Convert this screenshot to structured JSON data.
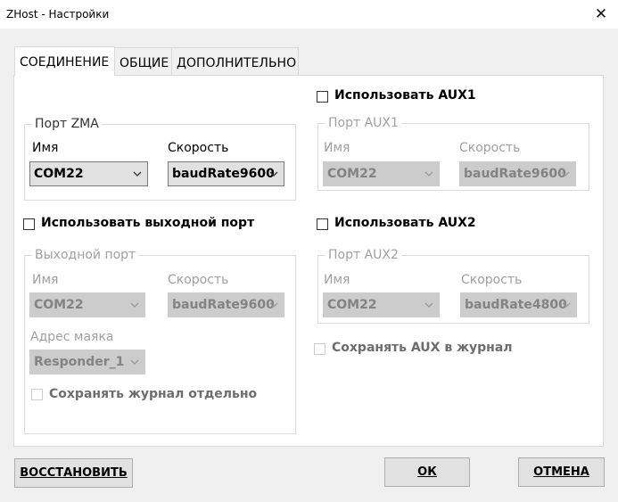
{
  "window": {
    "title": "ZHost - Настройки",
    "close_glyph": "✕"
  },
  "tabs": [
    {
      "label": "СОЕДИНЕНИЕ",
      "active": true
    },
    {
      "label": "ОБЩИЕ",
      "active": false
    },
    {
      "label": "ДОПОЛНИТЕЛЬНО",
      "active": false
    }
  ],
  "zma_port": {
    "title": "Порт ZMA",
    "name_label": "Имя",
    "name_value": "COM22",
    "speed_label": "Скорость",
    "speed_value": "baudRate9600"
  },
  "output_port": {
    "checkbox_label": "Использовать выходной порт",
    "checked": false,
    "title": "Выходной порт",
    "name_label": "Имя",
    "name_value": "COM22",
    "speed_label": "Скорость",
    "speed_value": "baudRate9600",
    "beacon_label": "Адрес маяка",
    "beacon_value": "Responder_1",
    "save_log_label": "Сохранять журнал отдельно",
    "save_log_checked": false
  },
  "aux1": {
    "checkbox_label": "Использовать AUX1",
    "checked": false,
    "title": "Порт AUX1",
    "name_label": "Имя",
    "name_value": "COM22",
    "speed_label": "Скорость",
    "speed_value": "baudRate9600"
  },
  "aux2": {
    "checkbox_label": "Использовать AUX2",
    "checked": false,
    "title": "Порт AUX2",
    "name_label": "Имя",
    "name_value": "COM22",
    "speed_label": "Скорость",
    "speed_value": "baudRate4800"
  },
  "save_aux_label": "Сохранять AUX в журнал",
  "save_aux_checked": false,
  "buttons": {
    "restore": "ВОССТАНОВИТЬ",
    "ok": "ОК",
    "cancel": "ОТМЕНА"
  }
}
